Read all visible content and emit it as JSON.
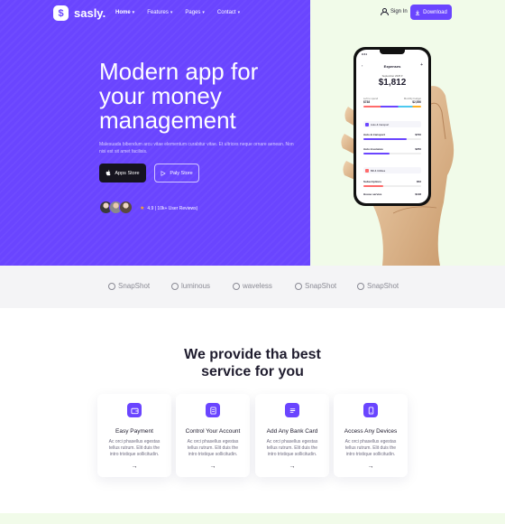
{
  "brand": {
    "logo_glyph": "$",
    "name": "sasly."
  },
  "nav": {
    "items": [
      {
        "label": "Home",
        "active": true
      },
      {
        "label": "Features",
        "active": false
      },
      {
        "label": "Pages",
        "active": false
      },
      {
        "label": "Contact",
        "active": false
      }
    ],
    "signin_label": "Sign In",
    "download_label": "Download"
  },
  "hero": {
    "headline": "Modern app for your money management",
    "subtext": "Malesuada bibendum arcu vitae elementum curabitur vitae. Et ultrices neque ornare aenean. Non nisi est sit amet facilisis.",
    "apps_store_label": "Apps Store",
    "play_store_label": "Paly Store",
    "rating_text": "4.9 | 10k+ User Reviews)"
  },
  "phone": {
    "time": "9:41",
    "title": "Expenses",
    "period": "September 2025 ▾",
    "amount": "$1,812",
    "left_label": "Left to spend",
    "left_value": "$738",
    "budget_label": "Monthly budget",
    "budget_value": "$2,550",
    "cat1": "Auto & transport",
    "row1_label": "Auto & transport",
    "row1_value": "$700",
    "row2_label": "Auto insurance",
    "row2_value": "$250",
    "cat2": "Bill & Utilities",
    "row3_label": "Subscriptions",
    "row3_value": "$52",
    "row4_label": "House service",
    "row4_value": "$138"
  },
  "partners": [
    "SnapShot",
    "luminous",
    "waveless",
    "SnapShot",
    "SnapShot"
  ],
  "services": {
    "title_line1": "We provide tha best",
    "title_line2": "service for you",
    "cards": [
      {
        "title": "Easy Payment",
        "text": "Ac orci phasellus egestas tellus rutrum. Elit duis the intro tristique sollicitudin.",
        "icon": "wallet-icon"
      },
      {
        "title": "Control Your Account",
        "text": "Ac orci phasellus egestas tellus rutrum. Elit duis the intro tristique sollicitudin.",
        "icon": "document-icon"
      },
      {
        "title": "Add Any Bank Card",
        "text": "Ac orci phasellus egestas tellus rutrum. Elit duis the intro tristique sollicitudin.",
        "icon": "card-icon"
      },
      {
        "title": "Access Any Devices",
        "text": "Ac orci phasellus egestas tellus rutrum. Elit duis the intro tristique sollicitudin.",
        "icon": "tablet-icon"
      }
    ],
    "arrow": "→"
  },
  "colors": {
    "accent": "#6a45ff",
    "mint": "#f1fbe9",
    "dark": "#16141f"
  }
}
